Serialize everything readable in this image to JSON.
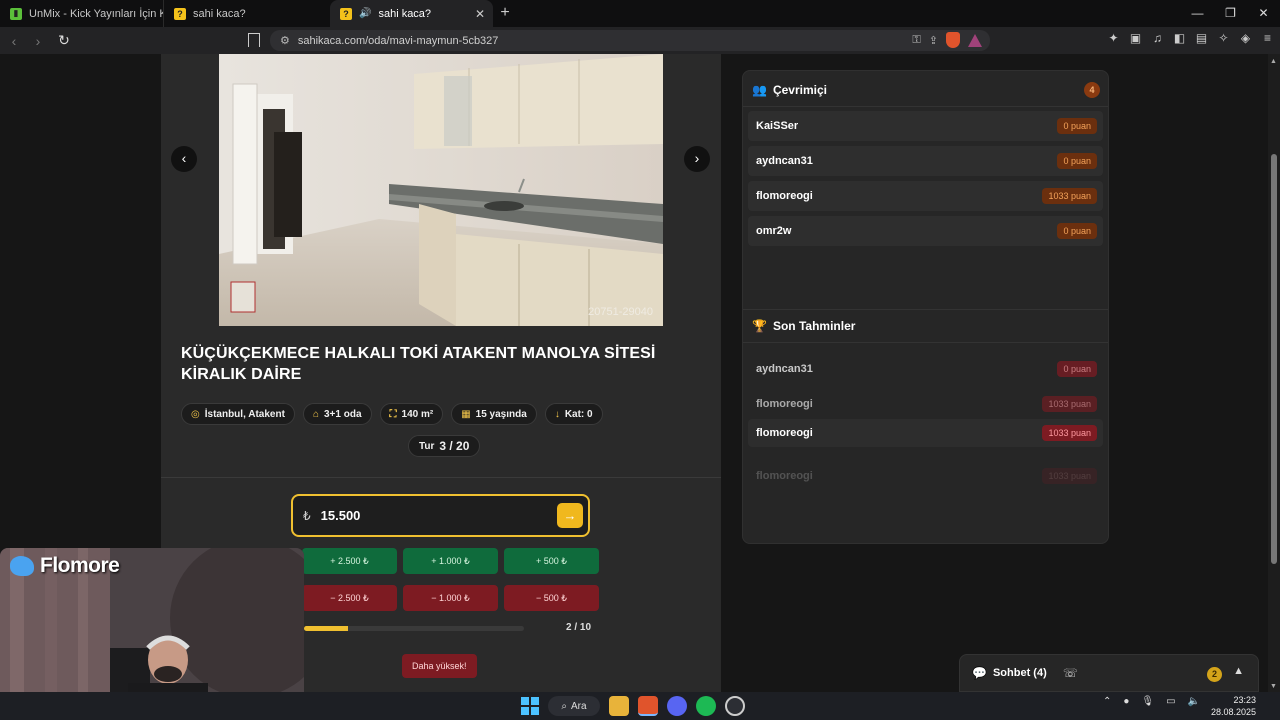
{
  "browser": {
    "tabs": [
      {
        "label": "UnMix - Kick Yayınları İçin Kelime Bu",
        "icon": "unmix-favicon"
      },
      {
        "label": "sahi kaca?",
        "icon": "question-favicon"
      },
      {
        "label": "sahi kaca?",
        "icon": "question-favicon",
        "active": true
      }
    ],
    "url": "sahikaca.com/oda/mavi-maymun-5cb327"
  },
  "listing": {
    "title": "KÜÇÜKÇEKMECE HALKALI TOKİ ATAKENT MANOLYA SİTESİ KİRALIK DAİRE",
    "photo_watermark": "20751-29040",
    "chips": [
      {
        "icon": "location-icon",
        "label": "İstanbul, Atakent"
      },
      {
        "icon": "home-icon",
        "label": "3+1 oda"
      },
      {
        "icon": "area-icon",
        "label": "140 m²"
      },
      {
        "icon": "building-icon",
        "label": "15 yaşında"
      },
      {
        "icon": "floor-icon",
        "label": "Kat: 0"
      }
    ],
    "round_label": "Tur",
    "round_value": "3 / 20"
  },
  "guess": {
    "currency": "₺",
    "value": "15.500",
    "plus_buttons": [
      "+ 2.500 ₺",
      "+ 1.000 ₺",
      "+ 500 ₺"
    ],
    "minus_buttons": [
      "− 2.500 ₺",
      "− 1.000 ₺",
      "− 500 ₺"
    ],
    "progress_label": "2 / 10",
    "progress_fraction": 0.2,
    "hint": "Daha yüksek!"
  },
  "online": {
    "title": "Çevrimiçi",
    "count": "4",
    "players": [
      {
        "name": "KaiSSer",
        "points": "0 puan"
      },
      {
        "name": "aydncan31",
        "points": "0 puan"
      },
      {
        "name": "flomoreogi",
        "points": "1033 puan"
      },
      {
        "name": "omr2w",
        "points": "0 puan"
      }
    ]
  },
  "recent": {
    "title": "Son Tahminler",
    "guesses": [
      {
        "name": "aydncan31",
        "points": "0 puan"
      },
      {
        "name": "flomoreogi",
        "points": "1033 puan"
      },
      {
        "name": "flomoreogi",
        "points": "1033 puan"
      },
      {
        "name": "flomoreogi",
        "points": "1033 puan"
      }
    ]
  },
  "chat": {
    "label": "Sohbet (4)",
    "badge": "2"
  },
  "webcam": {
    "name": "Flomore"
  },
  "taskbar": {
    "search_label": "Ara",
    "time": "23:23",
    "date": "28.08.2025"
  },
  "colors": {
    "accent": "#f0c030",
    "plus": "#0f6b3c",
    "minus": "#7d1b22"
  }
}
